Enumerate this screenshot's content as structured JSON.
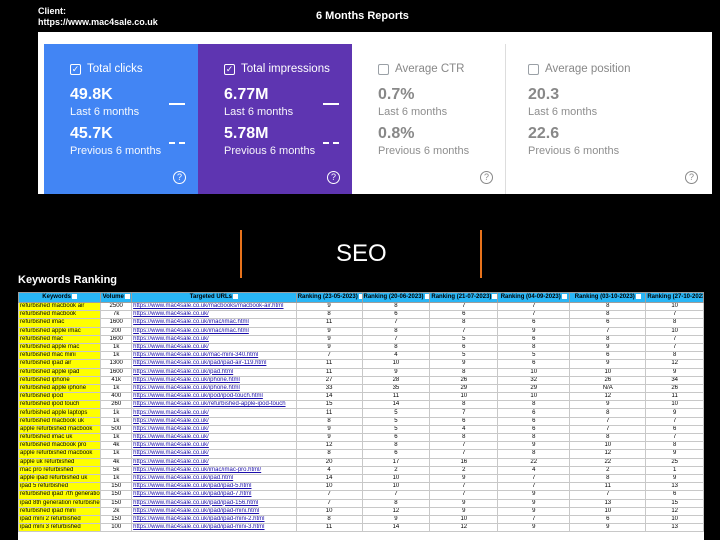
{
  "client": {
    "label": "Client:",
    "url": "https://www.mac4sale.co.uk"
  },
  "report_title": "6 Months Reports",
  "gsc": {
    "clicks": {
      "label": "Total clicks",
      "current": "49.8K",
      "current_period": "Last 6 months",
      "previous": "45.7K",
      "previous_period": "Previous 6 months",
      "checked": true
    },
    "impressions": {
      "label": "Total impressions",
      "current": "6.77M",
      "current_period": "Last 6 months",
      "previous": "5.78M",
      "previous_period": "Previous 6 months",
      "checked": true
    },
    "ctr": {
      "label": "Average CTR",
      "current": "0.7%",
      "current_period": "Last 6 months",
      "previous": "0.8%",
      "previous_period": "Previous 6 months",
      "checked": false
    },
    "position": {
      "label": "Average position",
      "current": "20.3",
      "current_period": "Last 6 months",
      "previous": "22.6",
      "previous_period": "Previous 6 months",
      "checked": false
    },
    "colors": {
      "clicks": "#4285f4",
      "impressions": "#5e35b1"
    }
  },
  "seo_label": "SEO",
  "keywords_title": "Keywords Ranking",
  "table": {
    "headers": [
      "Keywords",
      "Volume",
      "Targeted URLs",
      "Ranking (23-05-2023)",
      "Ranking (20-06-2023)",
      "Ranking (21-07-2023)",
      "Ranking (04-09-2023)",
      "Ranking (03-10-2023)",
      "Ranking (27-10-2023)"
    ],
    "rows": [
      [
        "refurbished macbook air",
        "2500",
        "https://www.mac4sale.co.uk/macbooks/macbook-air.html",
        "9",
        "8",
        "7",
        "7",
        "8",
        "10"
      ],
      [
        "refurbished macbook",
        "7k",
        "https://www.mac4sale.co.uk/",
        "8",
        "6",
        "6",
        "7",
        "8",
        "7"
      ],
      [
        "refurbished imac",
        "1600",
        "https://www.mac4sale.co.uk/imac/imac.html",
        "11",
        "7",
        "8",
        "6",
        "6",
        "8"
      ],
      [
        "refurbished apple imac",
        "200",
        "https://www.mac4sale.co.uk/imac/imac.html",
        "9",
        "8",
        "7",
        "9",
        "7",
        "10"
      ],
      [
        "refurbished mac",
        "1600",
        "https://www.mac4sale.co.uk/",
        "9",
        "7",
        "5",
        "6",
        "8",
        "7"
      ],
      [
        "refurbished apple mac",
        "1k",
        "https://www.mac4sale.co.uk/",
        "9",
        "8",
        "6",
        "8",
        "9",
        "7"
      ],
      [
        "refurbished mac mini",
        "1k",
        "https://www.mac4sale.co.uk/mac-mini-340.html",
        "7",
        "4",
        "5",
        "5",
        "6",
        "8"
      ],
      [
        "refurbished ipad air",
        "1300",
        "https://www.mac4sale.co.uk/ipad/ipad-air-119.html",
        "11",
        "10",
        "9",
        "6",
        "9",
        "12"
      ],
      [
        "refurbished apple ipad",
        "1600",
        "https://www.mac4sale.co.uk/ipad.html",
        "11",
        "9",
        "8",
        "10",
        "10",
        "9"
      ],
      [
        "refurbished iphone",
        "41k",
        "https://www.mac4sale.co.uk/iphone.html",
        "27",
        "28",
        "26",
        "32",
        "26",
        "34"
      ],
      [
        "refurbished apple iphone",
        "1k",
        "https://www.mac4sale.co.uk/iphone.html",
        "33",
        "35",
        "29",
        "29",
        "N/A",
        "26"
      ],
      [
        "refurbished ipod",
        "400",
        "https://www.mac4sale.co.uk/ipod/ipod-touch.html",
        "14",
        "11",
        "10",
        "10",
        "12",
        "11"
      ],
      [
        "refurbished ipod touch",
        "260",
        "https://www.mac4sale.co.uk/refurbished-apple-ipod-touch",
        "15",
        "14",
        "8",
        "8",
        "9",
        "10"
      ],
      [
        "refurbished apple laptops",
        "1k",
        "https://www.mac4sale.co.uk/",
        "11",
        "5",
        "7",
        "6",
        "8",
        "9"
      ],
      [
        "refurbished macbook uk",
        "1k",
        "https://www.mac4sale.co.uk/",
        "8",
        "5",
        "6",
        "6",
        "7",
        "7"
      ],
      [
        "apple refurbished macbook",
        "500",
        "https://www.mac4sale.co.uk/",
        "9",
        "5",
        "4",
        "6",
        "7",
        "6"
      ],
      [
        "refurbished imac uk",
        "1k",
        "https://www.mac4sale.co.uk/",
        "9",
        "6",
        "8",
        "8",
        "8",
        "7"
      ],
      [
        "refurbished macbook pro",
        "4k",
        "https://www.mac4sale.co.uk/",
        "12",
        "8",
        "7",
        "9",
        "10",
        "8"
      ],
      [
        "apple refurbished macbook",
        "1k",
        "https://www.mac4sale.co.uk/",
        "8",
        "6",
        "7",
        "8",
        "12",
        "9"
      ],
      [
        "apple uk refurbished",
        "4k",
        "https://www.mac4sale.co.uk/",
        "20",
        "17",
        "16",
        "22",
        "22",
        "25"
      ],
      [
        "mac pro refurbished",
        "5k",
        "https://www.mac4sale.co.uk/imac/imac-pro.html/",
        "4",
        "2",
        "2",
        "4",
        "2",
        "1"
      ],
      [
        "apple ipad refurbished uk",
        "1k",
        "https://www.mac4sale.co.uk/ipad.html",
        "14",
        "10",
        "9",
        "7",
        "8",
        "9"
      ],
      [
        "ipad 5 refurbished",
        "150",
        "https://www.mac4sale.co.uk/ipad/ipad-5.html",
        "10",
        "10",
        "7",
        "7",
        "11",
        "13"
      ],
      [
        "refurbished ipad 7th generation",
        "150",
        "https://www.mac4sale.co.uk/ipad/ipad-7.html",
        "7",
        "7",
        "7",
        "9",
        "7",
        "6"
      ],
      [
        "ipad 8th generation refurbished",
        "150",
        "https://www.mac4sale.co.uk/ipad/ipad-156.html",
        "7",
        "8",
        "9",
        "9",
        "13",
        "15"
      ],
      [
        "refurbished ipad mini",
        "2k",
        "https://www.mac4sale.co.uk/ipad/ipad-mini.html",
        "10",
        "12",
        "9",
        "9",
        "10",
        "12"
      ],
      [
        "ipad mini 2 refurbished",
        "150",
        "https://www.mac4sale.co.uk/ipad/ipad-mini-2.html",
        "8",
        "9",
        "10",
        "7",
        "6",
        "10"
      ],
      [
        "ipad mini 3 refurbished",
        "100",
        "https://www.mac4sale.co.uk/ipad/ipad-mini-3.html",
        "11",
        "14",
        "12",
        "9",
        "9",
        "13"
      ]
    ]
  }
}
